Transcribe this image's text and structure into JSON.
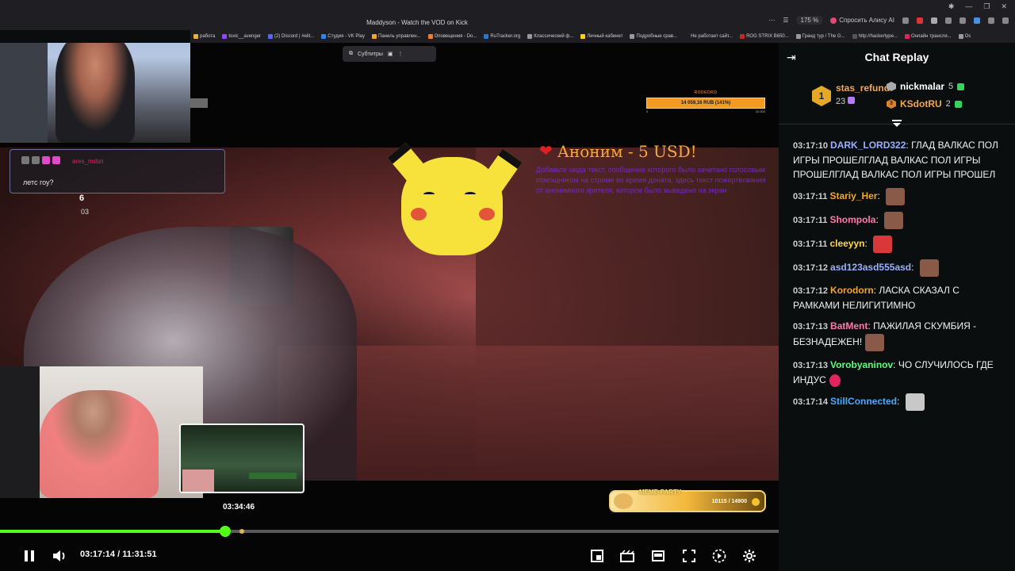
{
  "browser": {
    "title": "Maddyson - Watch the VOD on Kick",
    "zoom": "175 %",
    "alice_button": "Спросить Алису AI",
    "window_controls": [
      "—",
      "❐",
      "✕"
    ],
    "bookmarks": [
      "работа",
      "toxic__avenger",
      "(2) Discord | #elit...",
      "Студия - VK Play",
      "Панель управлен...",
      "Оповещения - Do...",
      "RuTracker.org",
      "Классический ф...",
      "Личный кабинет",
      "Подробные срав...",
      "Не работает сайт...",
      "ROG STRIX B650...",
      "Гранд тур / The G...",
      "http://hackertype...",
      "Онлайн трансля...",
      "Os"
    ]
  },
  "video": {
    "subtitles_label": "Субтитры",
    "overlay_chat": {
      "name": "ares_mdsn",
      "message": "летс гоу?"
    },
    "ammo": {
      "count": "6",
      "sub": "03"
    },
    "goal": {
      "label": "RODEORD",
      "amount": "14 059,16 RUB (141%)",
      "min": "0",
      "max": "10 000"
    },
    "donation": {
      "title": "Аноним - 5 USD!",
      "message": "Добавьте сюда текст, сообщение которого было зачитано голосовым помощником на стриме во время доната, здесь текст пожертвования от анонимного зрителя, которое было выведено на экран"
    },
    "meme_party": {
      "label": "MEME-PARTY",
      "value": "10115 / 14900"
    },
    "hover_time": "03:34:46",
    "progress_fraction": 0.289,
    "hover_fraction": 0.311,
    "current_time": "03:17:14 / 11:31:51"
  },
  "chat": {
    "title": "Chat Replay",
    "leaders": {
      "first": {
        "rank": "1",
        "name": "stas_refund",
        "count": "23"
      },
      "second": {
        "name": "nickmalar",
        "count": "5"
      },
      "third": {
        "rank": "3",
        "name": "KSdotRU",
        "count": "2"
      }
    },
    "messages": [
      {
        "time": "03:17:10",
        "user": "DARK_LORD322",
        "color": "#9ab0ff",
        "text": "ГЛАД ВАЛКАС ПОЛ ИГРЫ ПРОШЕЛГЛАД ВАЛКАС ПОЛ ИГРЫ ПРОШЕЛГЛАД ВАЛКАС ПОЛ ИГРЫ ПРОШЕЛ"
      },
      {
        "time": "03:17:11",
        "user": "Stariy_Her",
        "color": "#f5a623",
        "text": "",
        "emote": "face-emote"
      },
      {
        "time": "03:17:11",
        "user": "Shompola",
        "color": "#ff7aa8",
        "text": "",
        "emote": "face-emote"
      },
      {
        "time": "03:17:11",
        "user": "cleeyyn",
        "color": "#ffd84a",
        "text": "",
        "emote": "angry-emote"
      },
      {
        "time": "03:17:12",
        "user": "asd123asd555asd",
        "color": "#9ab0ff",
        "text": "",
        "emote": "face-emote"
      },
      {
        "time": "03:17:12",
        "user": "Korodorn",
        "color": "#f5a623",
        "text": "ЛАСКА СКАЗАЛ С РАМКАМИ НЕЛИГИТИМНО"
      },
      {
        "time": "03:17:13",
        "user": "BatMent",
        "color": "#ff7aa8",
        "text": "ПАЖИЛАЯ СКУМБИЯ - БЕЗНАДЕЖЕН!",
        "emote": "face-emote"
      },
      {
        "time": "03:17:13",
        "user": "Vorobyaninov",
        "color": "#5bff7a",
        "text": "ЧО СЛУЧИЛОСЬ ГДЕ ИНДУС",
        "emote": "gem-emote"
      },
      {
        "time": "03:17:14",
        "user": "StillConnected",
        "color": "#4aa8ff",
        "text": "",
        "emote": "cat-emote"
      }
    ]
  },
  "colors": {
    "kick_green": "#53fc18",
    "chat_bg": "#0b0e0f"
  }
}
